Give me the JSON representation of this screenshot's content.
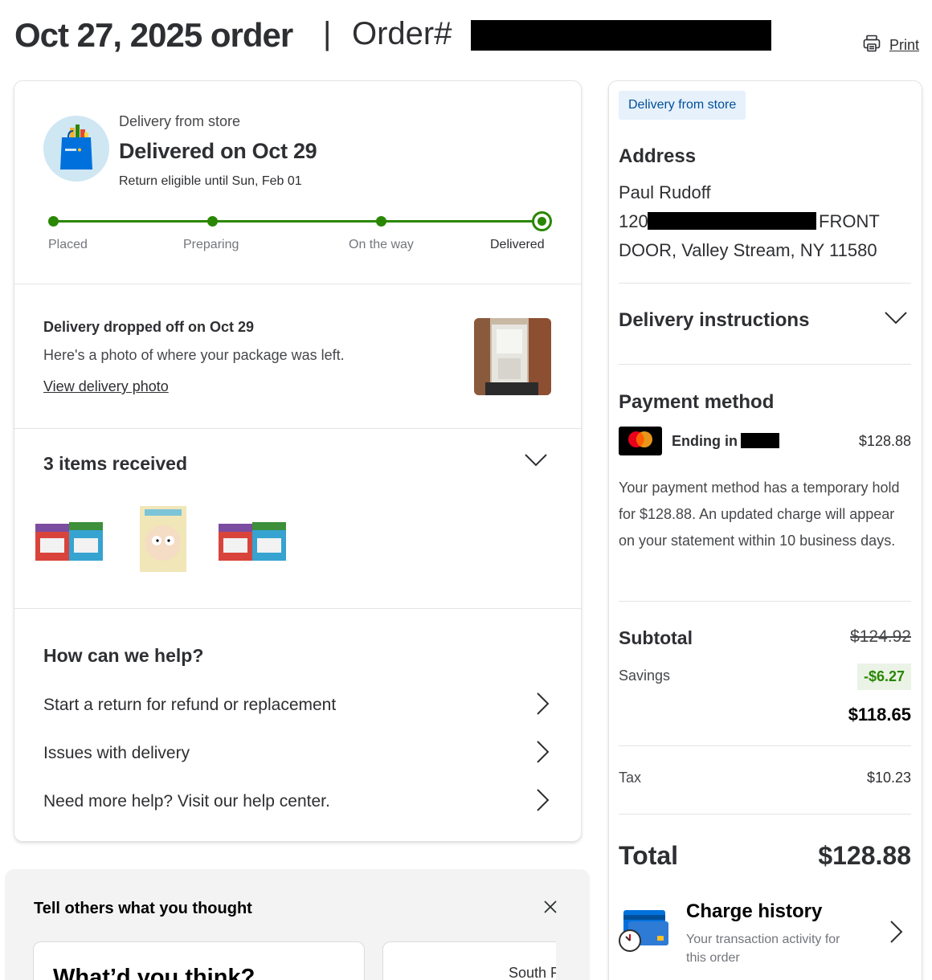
{
  "header": {
    "order_date_title": "Oct 27, 2025 order",
    "separator": "|",
    "order_number_label": "Order#",
    "print_label": "Print"
  },
  "status": {
    "subtitle": "Delivery from store",
    "headline": "Delivered on Oct 29",
    "return_note": "Return eligible until Sun, Feb 01",
    "steps": [
      "Placed",
      "Preparing",
      "On the way",
      "Delivered"
    ],
    "current_step": 4
  },
  "delivery_photo": {
    "title": "Delivery dropped off on Oct 29",
    "description": "Here's a photo of where your package was left.",
    "link": "View delivery photo"
  },
  "items": {
    "title": "3 items received",
    "count": 3
  },
  "help": {
    "title": "How can we help?",
    "options": [
      "Start a return for refund or replacement",
      "Issues with delivery",
      "Need more help? Visit our help center."
    ]
  },
  "feedback": {
    "title": "Tell others what you thought",
    "card1_title": "What’d you think?",
    "card2_text": "South P"
  },
  "summary": {
    "tag": "Delivery from store",
    "address_heading": "Address",
    "address_name": "Paul Rudoff",
    "address_line1_start": "120",
    "address_line1_end": "FRONT",
    "address_line2": "DOOR, Valley Stream, NY 11580",
    "instructions_heading": "Delivery instructions",
    "payment_heading": "Payment method",
    "card_ending_label": "Ending in",
    "payment_amount": "$128.88",
    "payment_note": "Your payment method has a temporary hold for $128.88. An updated charge will appear on your statement within 10 business days.",
    "subtotal_label": "Subtotal",
    "subtotal_original": "$124.92",
    "savings_label": "Savings",
    "savings_value": "-$6.27",
    "subtotal_final": "$118.65",
    "tax_label": "Tax",
    "tax_value": "$10.23",
    "total_label": "Total",
    "total_value": "$128.88",
    "charge_history_title": "Charge history",
    "charge_history_sub": "Your transaction activity for this order"
  },
  "colors": {
    "progress_green": "#2a8703",
    "tag_blue": "#004f9a",
    "tag_bg": "#e6f1fc",
    "savings_bg": "#eaf3e6"
  },
  "icons": [
    "printer-icon",
    "walmart-bag-icon",
    "chevron-down-icon",
    "chevron-right-icon",
    "close-icon",
    "mastercard-logo",
    "credit-card-clock-icon"
  ]
}
